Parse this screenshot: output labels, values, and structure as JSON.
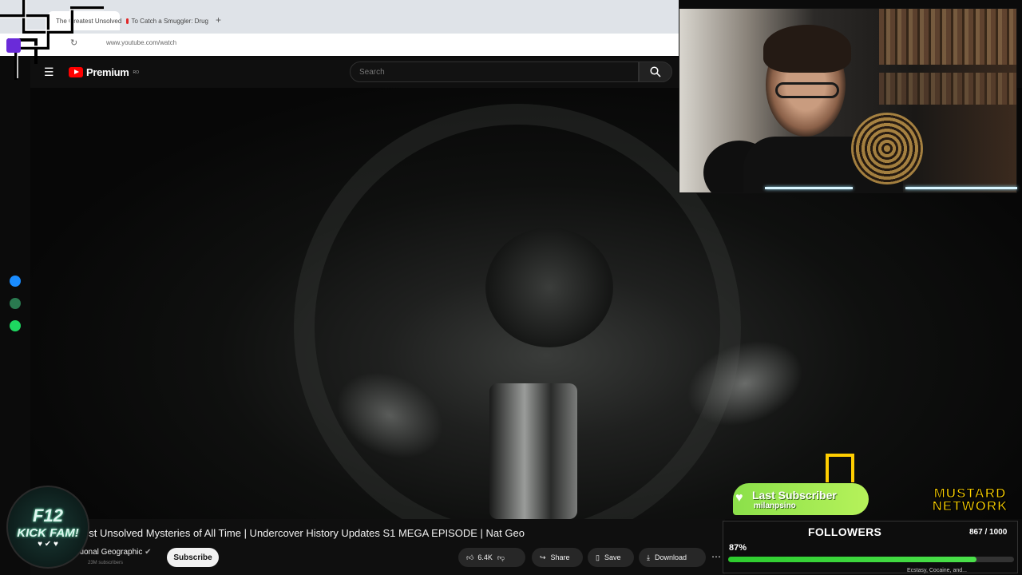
{
  "browser": {
    "tabs": [
      {
        "label": "The Greatest Unsolved"
      },
      {
        "label": "To Catch a Smuggler: Drug"
      }
    ],
    "new_tab_icon": "plus-icon",
    "url": "www.youtube.com/watch"
  },
  "youtube": {
    "logo_text": "Premium",
    "region": "RO",
    "search_placeholder": "Search"
  },
  "video": {
    "title": "est Unsolved Mysteries of All Time | Undercover History Updates S1 MEGA EPISODE | Nat Geo",
    "channel": "tional Geographic",
    "subscribers": "23M subscribers",
    "subscribe_label": "Subscribe",
    "likes": "6.4K",
    "share_label": "Share",
    "save_label": "Save",
    "download_label": "Download"
  },
  "side_icons": [
    "messenger-icon",
    "whatsapp-icon",
    "spotify-icon"
  ],
  "overlay": {
    "badge_line1": "F12",
    "badge_line2": "KICK FAM!",
    "last_subscriber_title": "Last Subscriber",
    "last_subscriber_name": "milanpsino",
    "brand_line1": "MUSTARD",
    "brand_line2": "NETWORK",
    "followers_title": "FOLLOWERS",
    "followers_count": "867 / 1000",
    "followers_percent_label": "87%",
    "followers_progress": 0.87,
    "ticker": "Ecstasy, Cocaine, and..."
  },
  "colors": {
    "youtube_red": "#ff0000",
    "progress_green": "#2ecc2e",
    "sub_green": "#8be04a",
    "mustard_yellow": "#ffd400"
  }
}
